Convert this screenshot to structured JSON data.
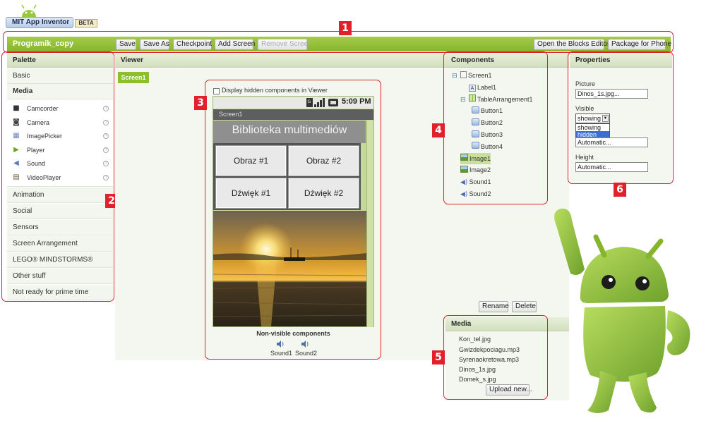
{
  "logo": {
    "title": "MIT App Inventor",
    "badge": "BETA"
  },
  "toolbar": {
    "project": "Programik_copy",
    "buttons": [
      "Save",
      "Save As",
      "Checkpoint",
      "Add Screen",
      "Remove Screen"
    ],
    "right_buttons": [
      "Open the Blocks Editor",
      "Package for Phone"
    ]
  },
  "palette": {
    "title": "Palette",
    "groups_top": [
      "Basic",
      "Media"
    ],
    "media_items": [
      {
        "label": "Camcorder",
        "icon": "camcorder-icon"
      },
      {
        "label": "Camera",
        "icon": "camera-icon"
      },
      {
        "label": "ImagePicker",
        "icon": "image-picker-icon"
      },
      {
        "label": "Player",
        "icon": "play-icon"
      },
      {
        "label": "Sound",
        "icon": "speaker-icon"
      },
      {
        "label": "VideoPlayer",
        "icon": "film-icon"
      }
    ],
    "groups_bottom": [
      "Animation",
      "Social",
      "Sensors",
      "Screen Arrangement",
      "LEGO® MINDSTORMS®",
      "Other stuff",
      "Not ready for prime time"
    ],
    "help_glyph": "?"
  },
  "viewer": {
    "title": "Viewer",
    "screen_tab": "Screen1",
    "checkbox_label": "Display hidden components in Viewer",
    "time": "5:09 PM",
    "screen_title": "Screen1",
    "app_label": "Biblioteka multimediów",
    "cells": [
      "Obraz #1",
      "Obraz #2",
      "Dźwięk #1",
      "Dźwięk #2"
    ],
    "nonvisible_title": "Non-visible components",
    "nonvisible": [
      "Sound1",
      "Sound2"
    ]
  },
  "components": {
    "title": "Components",
    "tree": [
      {
        "label": "Screen1",
        "level": 0,
        "icon": "screen-icon",
        "toggle": "⊟"
      },
      {
        "label": "Label1",
        "level": 1,
        "icon": "label-icon"
      },
      {
        "label": "TableArrangement1",
        "level": 1,
        "icon": "table-icon",
        "toggle": "⊟"
      },
      {
        "label": "Button1",
        "level": 2,
        "icon": "button-icon"
      },
      {
        "label": "Button2",
        "level": 2,
        "icon": "button-icon"
      },
      {
        "label": "Button3",
        "level": 2,
        "icon": "button-icon"
      },
      {
        "label": "Button4",
        "level": 2,
        "icon": "button-icon"
      },
      {
        "label": "Image1",
        "level": 1,
        "icon": "image-icon",
        "selected": true
      },
      {
        "label": "Image2",
        "level": 1,
        "icon": "image-icon"
      },
      {
        "label": "Sound1",
        "level": 1,
        "icon": "speaker-icon"
      },
      {
        "label": "Sound2",
        "level": 1,
        "icon": "speaker-icon"
      }
    ],
    "rename": "Rename",
    "delete": "Delete"
  },
  "media": {
    "title": "Media",
    "files": [
      "Kon_tel.jpg",
      "Gwizdekpociagu.mp3",
      "Syrenaokretowa.mp3",
      "Dinos_1s.jpg",
      "Domek_s.jpg"
    ],
    "upload": "Upload new..."
  },
  "properties": {
    "title": "Properties",
    "picture_label": "Picture",
    "picture_value": "Dinos_1s.jpg...",
    "visible_label": "Visible",
    "visible_value": "showing",
    "visible_options": [
      "showing",
      "hidden"
    ],
    "width_value": "Automatic...",
    "height_label": "Height",
    "height_value": "Automatic..."
  },
  "markers": [
    "1",
    "2",
    "3",
    "4",
    "5",
    "6"
  ],
  "colors": {
    "accent": "#8bbf2b",
    "marker": "#e0202a",
    "android": "#97c93d"
  }
}
